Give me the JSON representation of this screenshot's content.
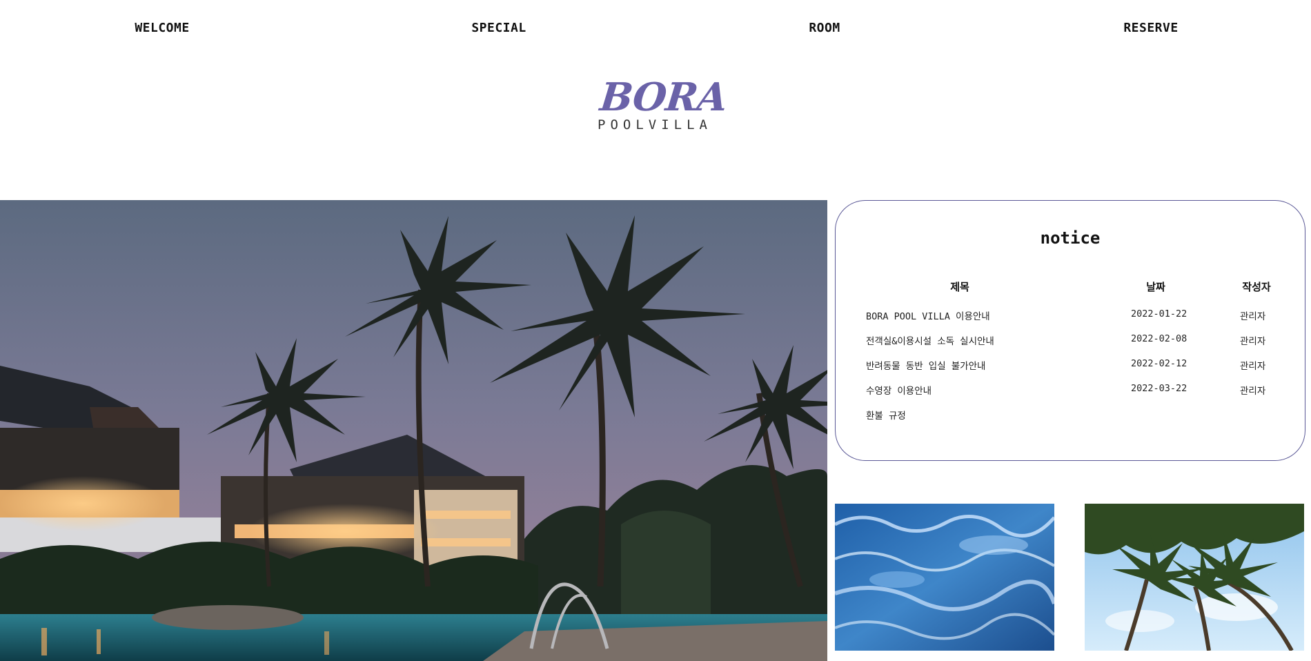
{
  "nav": {
    "items": [
      {
        "label": "WELCOME"
      },
      {
        "label": "SPECIAL"
      },
      {
        "label": "ROOM"
      },
      {
        "label": "RESERVE"
      }
    ]
  },
  "logo": {
    "word": "BORA",
    "sub": "POOLVILLA",
    "color": "#6a62a8"
  },
  "notice": {
    "title": "notice",
    "columns": [
      "제목",
      "날짜",
      "작성자"
    ],
    "rows": [
      {
        "title": "BORA POOL VILLA 이용안내",
        "date": "2022-01-22",
        "author": "관리자"
      },
      {
        "title": "전객실&이용시설 소독 실시안내",
        "date": "2022-02-08",
        "author": "관리자"
      },
      {
        "title": "반려동물 동반 입실 불가안내",
        "date": "2022-02-12",
        "author": "관리자"
      },
      {
        "title": "수영장 이용안내",
        "date": "2022-03-22",
        "author": "관리자"
      },
      {
        "title": "환불 규정",
        "date": "",
        "author": ""
      }
    ],
    "border_color": "#5a5896"
  },
  "images": {
    "hero": "resort-pool-night-palm-trees",
    "thumb_left": "pool-water-ripples",
    "thumb_right": "palm-trees-sky"
  }
}
